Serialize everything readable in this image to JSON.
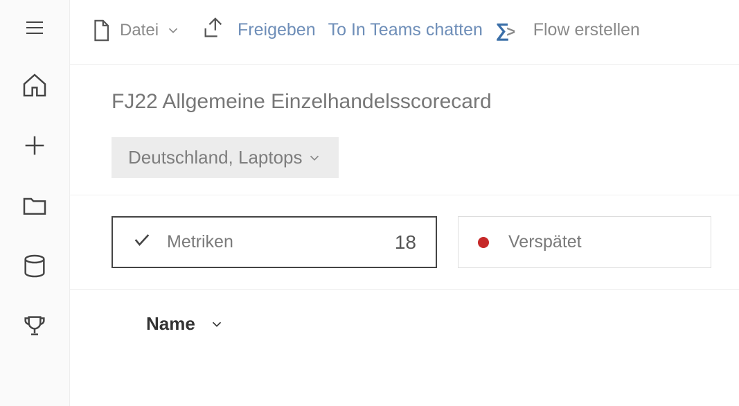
{
  "toolbar": {
    "file_label": "Datei",
    "share_label": "Freigeben",
    "chat_label": "To In Teams chatten",
    "flow_label": "Flow erstellen"
  },
  "header": {
    "title": "FJ22 Allgemeine Einzelhandelsscorecard",
    "filter_label": "Deutschland, Laptops"
  },
  "cards": {
    "metrics_label": "Metriken",
    "metrics_count": "18",
    "late_label": "Verspätet"
  },
  "table": {
    "col_name": "Name"
  }
}
